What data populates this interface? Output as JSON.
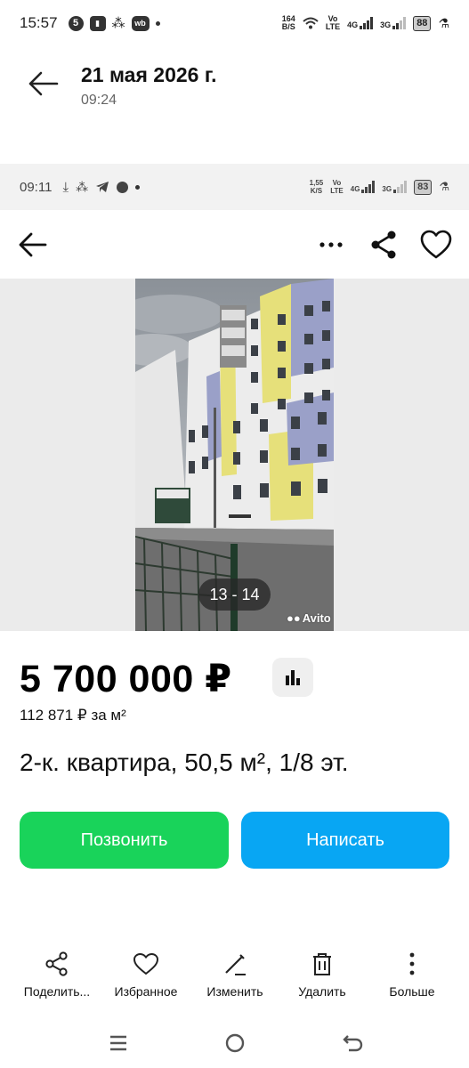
{
  "status_bar": {
    "time": "15:57",
    "app_badge_1": "5",
    "app_badge_3": "wb",
    "net_speed": "164",
    "net_speed_unit": "B/S",
    "volte_1": "Vo",
    "volte_2": "LTE",
    "net_4g": "4G",
    "net_3g": "3G",
    "battery": "88"
  },
  "gallery_header": {
    "date": "21 мая 2026 г.",
    "time": "09:24"
  },
  "inner_status_bar": {
    "time": "09:11",
    "net_speed": "1,55",
    "net_speed_unit": "K/S",
    "volte_1": "Vo",
    "volte_2": "LTE",
    "net_4g": "4G",
    "net_3g": "3G",
    "battery": "83"
  },
  "listing": {
    "photo_counter": "13 - 14",
    "watermark": "Avito",
    "price": "5 700 000 ₽",
    "price_per_m": "112 871 ₽ за м²",
    "title": "2-к. квартира, 50,5 м², 1/8 эт.",
    "call_label": "Позвонить",
    "write_label": "Написать"
  },
  "actions": [
    {
      "label": "Поделить...",
      "icon": "share-icon"
    },
    {
      "label": "Избранное",
      "icon": "heart-icon"
    },
    {
      "label": "Изменить",
      "icon": "pencil-icon"
    },
    {
      "label": "Удалить",
      "icon": "trash-icon"
    },
    {
      "label": "Больше",
      "icon": "more-vertical-icon"
    }
  ],
  "colors": {
    "call": "#19d35a",
    "write": "#08a6f3",
    "building_yellow": "#e6e07a",
    "building_lilac": "#9aa0c8"
  }
}
